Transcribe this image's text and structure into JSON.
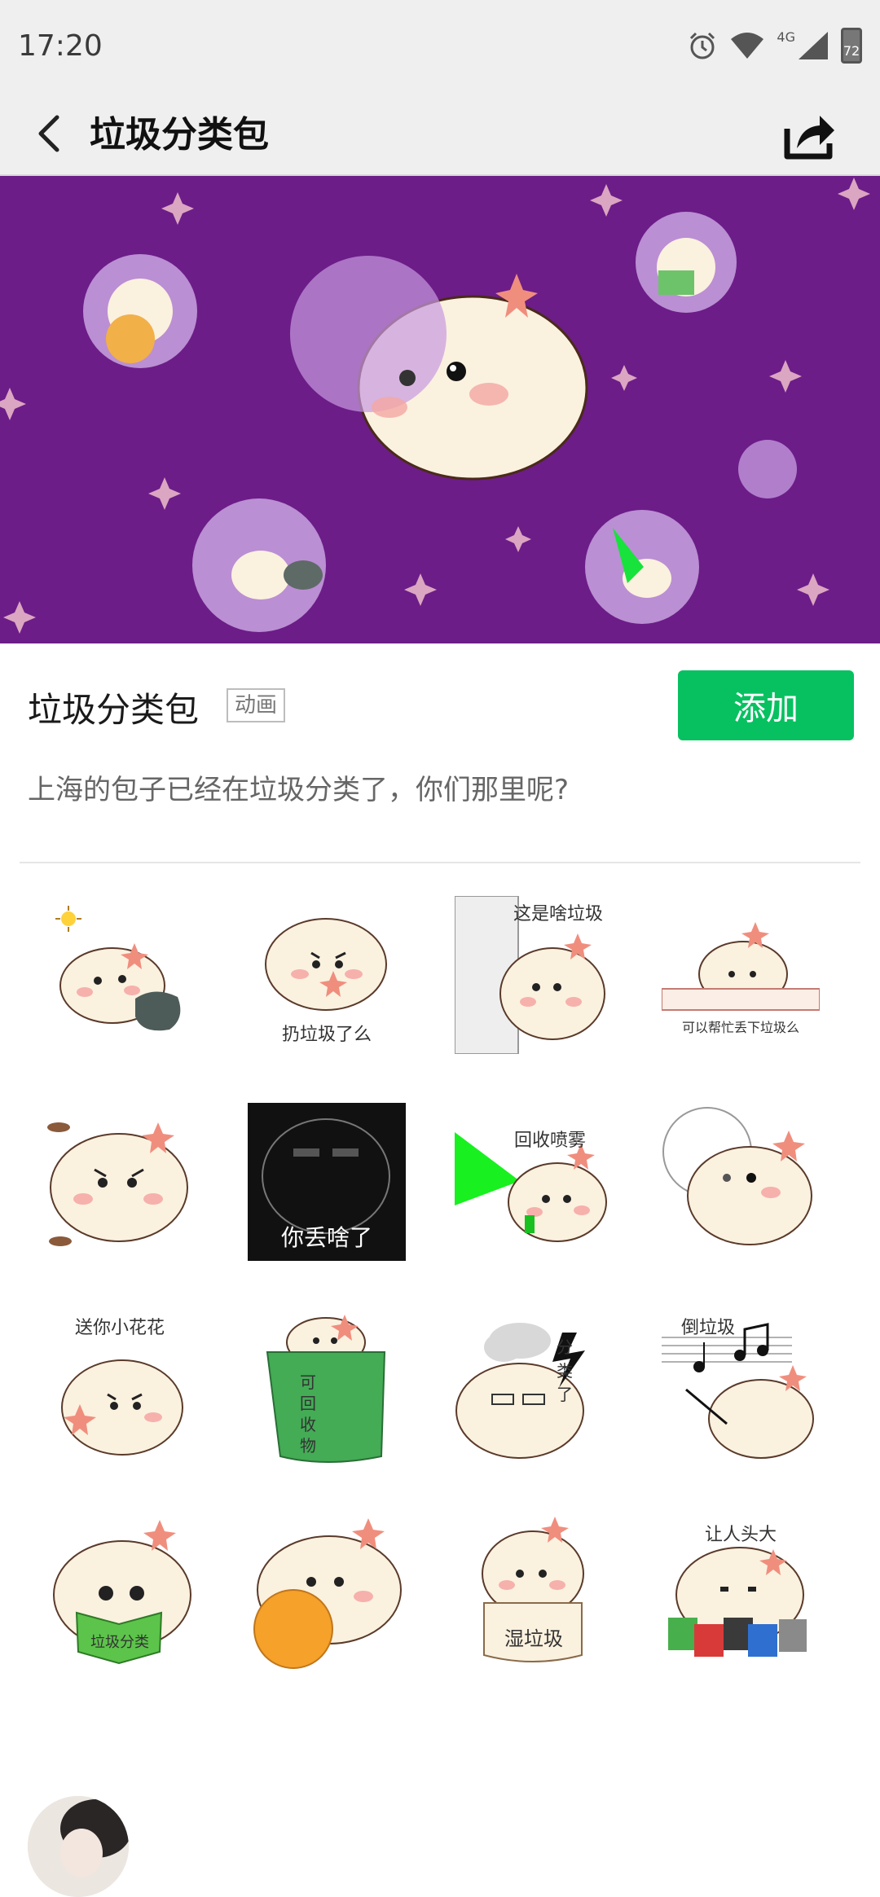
{
  "status_bar": {
    "time": "17:20",
    "network": "4G",
    "battery": "72",
    "icons": [
      "alarm-icon",
      "wifi-icon",
      "signal-icon",
      "battery-icon"
    ]
  },
  "app_bar": {
    "title": "垃圾分类包",
    "back_icon": "back-arrow-icon",
    "share_icon": "share-icon"
  },
  "pack": {
    "name": "垃圾分类包",
    "tag": "动画",
    "add_label": "添加",
    "description": "上海的包子已经在垃圾分类了，你们那里呢?"
  },
  "colors": {
    "accent": "#07c160",
    "banner_bg": "#6c1d88"
  },
  "stickers": [
    {
      "caption": ""
    },
    {
      "caption": "扔垃圾了么"
    },
    {
      "caption": "这是啥垃圾"
    },
    {
      "caption": "可以帮忙丢下垃圾么"
    },
    {
      "caption": ""
    },
    {
      "caption": "你丢啥了"
    },
    {
      "caption": "回收喷雾"
    },
    {
      "caption": ""
    },
    {
      "caption": "送你小花花"
    },
    {
      "caption": "可回收物"
    },
    {
      "caption": "分类了"
    },
    {
      "caption": "倒垃圾"
    },
    {
      "caption": "垃圾分类"
    },
    {
      "caption": ""
    },
    {
      "caption": "湿垃圾"
    },
    {
      "caption": "让人头大"
    }
  ]
}
